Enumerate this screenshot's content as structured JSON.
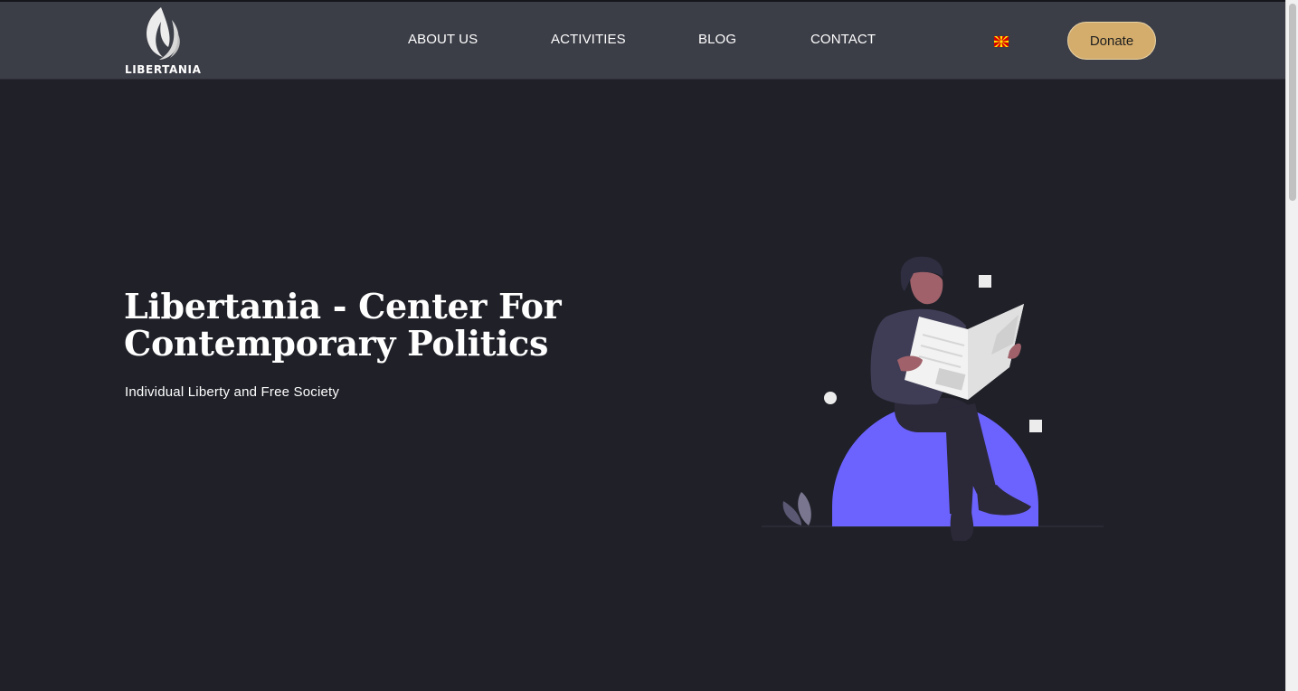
{
  "brand": {
    "name": "LIBERTANIA"
  },
  "nav": {
    "items": [
      {
        "label": "ABOUT US"
      },
      {
        "label": "ACTIVITIES"
      },
      {
        "label": "BLOG"
      },
      {
        "label": "CONTACT"
      }
    ],
    "language_flag": "macedonia-flag-icon",
    "donate_label": "Donate"
  },
  "hero": {
    "title_line1": "Libertania - Center For",
    "title_line2": "Contemporary Politics",
    "subtitle": "Individual Liberty and Free Society",
    "illustration": "man-reading-newspaper-illustration"
  },
  "colors": {
    "background": "#1f2028",
    "header": "#3b3d47",
    "accent_donate": "#d4ad6c",
    "illustration_accent": "#6c63ff"
  }
}
